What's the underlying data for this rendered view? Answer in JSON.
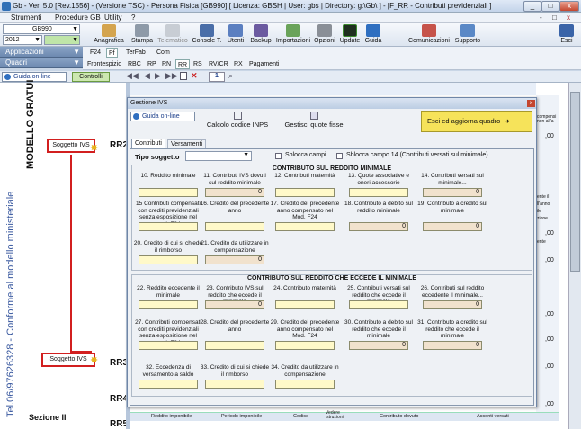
{
  "window": {
    "title": "Gb - Ver. 5.0 [Rev.1556] - (Versione TSC) - Persona Fisica [GB990]    [ Licenza: GBSH | User: gbs | Directory: g:\\Gb\\ ]  - [F_RR - Contributi previdenziali ]",
    "minimize": "_",
    "maximize": "□",
    "close": "x",
    "inner_controls": [
      "-",
      "□",
      "x"
    ]
  },
  "menu": {
    "items": [
      "Strumenti",
      "Procedure GB",
      "Utility",
      "?"
    ]
  },
  "toolbar": {
    "model_combo": "GB990",
    "year_combo": "2012",
    "buttons": [
      "Anagrafica",
      "Stampa",
      "Telematico",
      "Console T.",
      "Utenti",
      "Backup",
      "Importazioni",
      "Opzioni",
      "Update",
      "Guida",
      "Comunicazioni",
      "Supporto",
      "Esci"
    ]
  },
  "leftnav": {
    "applicazioni": "Applicazioni",
    "quadri": "Quadri"
  },
  "tabs_row1": [
    "F24",
    "Pf",
    "TerFab",
    "Com"
  ],
  "tabs_row2": [
    "Frontespizio",
    "RBC",
    "RP",
    "RN",
    "RR",
    "RS",
    "RV/CR",
    "RX",
    "Pagamenti"
  ],
  "guidebar": {
    "guida": "Guida on-line",
    "controlli": "Controlli",
    "page": "1"
  },
  "form": {
    "side_title": "MODELLO GRATUI",
    "side_text": "Tel.06/97626328 - Conforme al modello ministeriale",
    "soggetto1": "Soggetto IVS",
    "soggetto2": "Soggetto IVS",
    "rr2": "RR2",
    "rr3": "RR3",
    "rr4": "RR4",
    "rr5": "RR5",
    "sezione": "Sezione II",
    "bottom_headers": [
      "Reddito imponibile",
      "Periodo imponibile",
      "Codice",
      "Vedere istruzioni",
      "Contributo dovuto",
      "Acconti versati"
    ],
    "right_labels": [
      "compensi non all'a",
      "ente il",
      "ll'anno",
      "ile",
      "zione",
      "ente"
    ],
    "right_values": [
      ",00",
      ",00",
      ",00",
      ",00",
      ",00",
      ",00",
      ",00"
    ]
  },
  "dialog": {
    "title": "Gestione IVS",
    "guida": "Guida on-line",
    "btn_calc": "Calcolo codice INPS",
    "btn_quote": "Gestisci quote fisse",
    "btn_exit": "Esci ed aggiorna quadro",
    "tabs": [
      "Contributi",
      "Versamenti"
    ],
    "tipo_label": "Tipo soggetto",
    "tipo_value": "",
    "chk1": "Sblocca campi",
    "chk2": "Sblocca campo 14 (Contributi versati sul minimale)",
    "section1": "CONTRIBUTO SUL REDDITO MINIMALE",
    "s1_row1": [
      {
        "label": "10. Reddito minimale",
        "value": ""
      },
      {
        "label": "11. Contributi IVS dovuti sul reddito minimale",
        "value": "0"
      },
      {
        "label": "12. Contributi maternità",
        "value": ""
      },
      {
        "label": "13. Quote associative e oneri accessorie",
        "value": ""
      },
      {
        "label": "14. Contributi versati sul minimale...",
        "value": "0"
      }
    ],
    "s1_row2": [
      {
        "label": "15 Contributi compensati con crediti previdenziali senza esposizione nel mod. F24",
        "value": ""
      },
      {
        "label": "16. Credito del precedente anno",
        "value": ""
      },
      {
        "label": "17. Credito del precedente anno compensato nel Mod. F24",
        "value": ""
      },
      {
        "label": "18. Contributo a debito sul reddito minimale",
        "value": "0"
      },
      {
        "label": "19. Contributo a credito sul minimale",
        "value": "0"
      }
    ],
    "s1_row3": [
      {
        "label": "20. Credito di cui si chiede il rimborso",
        "value": ""
      },
      {
        "label": "21. Credito da utilizzare in compensazione",
        "value": "0"
      }
    ],
    "section2": "CONTRIBUTO SUL REDDITO CHE ECCEDE IL MINIMALE",
    "s2_row1": [
      {
        "label": "22. Reddito eccedente il minimale",
        "value": ""
      },
      {
        "label": "23. Contributo IVS sul reddito che eccede il minimale",
        "value": "0"
      },
      {
        "label": "24. Contributo maternità",
        "value": ""
      },
      {
        "label": "25. Contributi versati sul reddito che eccede il minimale",
        "value": ""
      },
      {
        "label": "26. Contributi sul reddito eccedente il minimale...",
        "value": "0"
      }
    ],
    "s2_row2": [
      {
        "label": "27. Contributi compensati con crediti previdenziali senza esposizione nel mod. F24",
        "value": ""
      },
      {
        "label": "28. Credito del precedente anno",
        "value": ""
      },
      {
        "label": "29. Credito del precedente anno compensato nel Mod. F24",
        "value": ""
      },
      {
        "label": "30. Contributo a debito sul reddito che eccede il minimale",
        "value": "0"
      },
      {
        "label": "31. Contributo a credito sul reddito che eccede il minimale",
        "value": "0"
      }
    ],
    "s2_row3": [
      {
        "label": "32. Eccedenza di versamento a saldo",
        "value": ""
      },
      {
        "label": "33. Credito di cui si chiede il rimborso",
        "value": ""
      },
      {
        "label": "34. Credito da utilizzare in compensazione",
        "value": ""
      }
    ]
  },
  "colors": {
    "field": "#fff9c9",
    "computed": "#f1e2cd",
    "callout": "#d21f1f",
    "exit_button": "#f6e35a"
  }
}
